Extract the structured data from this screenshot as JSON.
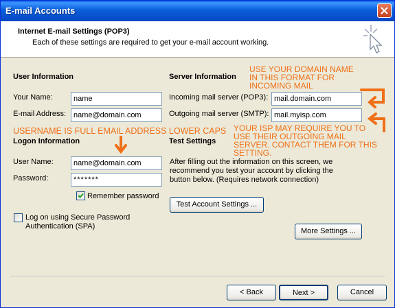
{
  "window": {
    "title": "E-mail Accounts"
  },
  "header": {
    "title": "Internet E-mail Settings (POP3)",
    "subtitle": "Each of these settings are required to get your e-mail account working."
  },
  "user_info": {
    "heading": "User Information",
    "name_label": "Your Name:",
    "name_value": "name",
    "email_label": "E-mail Address:",
    "email_value": "name@domain.com"
  },
  "server_info": {
    "heading": "Server Information",
    "incoming_label": "Incoming mail server (POP3):",
    "incoming_value": "mail.domain.com",
    "outgoing_label": "Outgoing mail server (SMTP):",
    "outgoing_value": "mail.myisp.com"
  },
  "logon_info": {
    "heading": "Logon Information",
    "username_label": "User Name:",
    "username_value": "name@domain.com",
    "password_label": "Password:",
    "password_value": "*******",
    "remember_label": "Remember password",
    "remember_checked": true,
    "spa_label_line1": "Log on using Secure Password",
    "spa_label_line2": "Authentication (SPA)",
    "spa_checked": false
  },
  "test_settings": {
    "heading": "Test Settings",
    "description": "After filling out the information on this screen, we recommend you test your account by clicking the button below. (Requires network connection)",
    "button_label": "Test Account Settings ..."
  },
  "more_settings_label": "More Settings ...",
  "footer": {
    "back_label": "< Back",
    "next_label": "Next >",
    "cancel_label": "Cancel"
  },
  "annotations": {
    "domain_note": [
      "USE YOUR DOMAIN NAME",
      "IN THIS FORMAT FOR",
      "INCOMING MAIL"
    ],
    "username_note": "USERNAME IS FULL EMAIL ADDRESS LOWER CAPS",
    "isp_note": [
      "YOUR ISP MAY REQUIRE YOU TO",
      "USE THEIR OUTGOING MAIL",
      "SERVER. CONTACT THEM FOR THIS",
      "SETTING."
    ],
    "color": "#ef7018"
  },
  "colors": {
    "title_bar": "#0a5fd9",
    "dialog_bg": "#ece9d8",
    "input_border": "#7f9db9"
  }
}
